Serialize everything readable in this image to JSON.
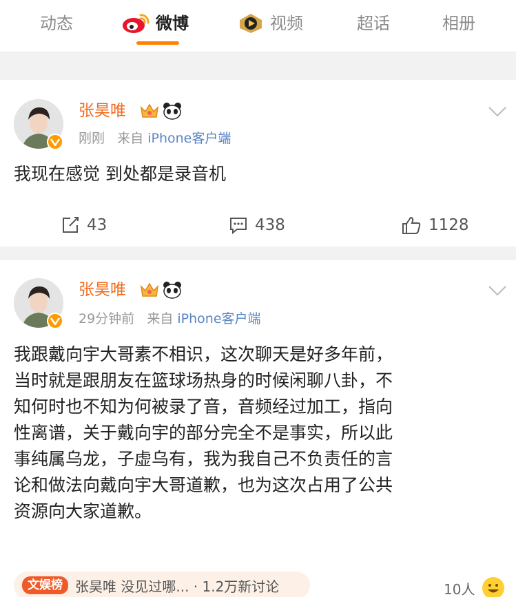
{
  "tabs": [
    {
      "label": "动态",
      "icon": ""
    },
    {
      "label": "微博",
      "icon": "weibo-logo-icon"
    },
    {
      "label": "视频",
      "icon": "video-play-icon"
    },
    {
      "label": "超话",
      "icon": ""
    },
    {
      "label": "相册",
      "icon": ""
    }
  ],
  "active_tab": "微博",
  "accent_color": "#ff8200",
  "posts": [
    {
      "author": "张昊唯",
      "time": "刚刚",
      "source_prefix": "来自",
      "source": "iPhone客户端",
      "text": "我现在感觉 到处都是录音机",
      "reposts": "43",
      "comments": "438",
      "likes": "1128"
    },
    {
      "author": "张昊唯",
      "time": "29分钟前",
      "source_prefix": "来自",
      "source": "iPhone客户端",
      "text_lines": [
        "我跟戴向宇大哥素不相识，这次聊天是好多年前，",
        "当时就是跟朋友在篮球场热身的时候闲聊八卦，不",
        "知何时也不知为何被录了音，音频经过加工，指向",
        "性离谱，关于戴向宇的部分完全不是事实，所以此",
        "事纯属乌龙，子虚乌有，我为我自己不负责任的言",
        "论和做法向戴向宇大哥道歉，也为这次占用了公共",
        "资源向大家道歉。"
      ]
    }
  ],
  "hotbar": {
    "tag": "文娱榜",
    "text": "张昊唯 没见过哪...  · 1.2万新讨论"
  },
  "reader_count": "10人"
}
